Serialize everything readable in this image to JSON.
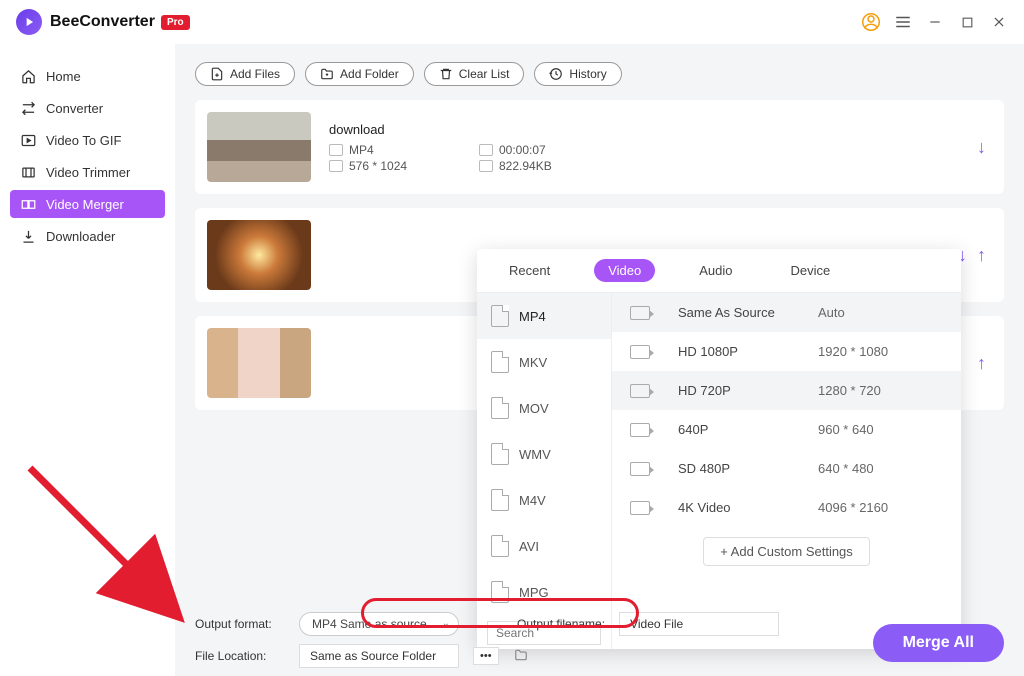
{
  "app": {
    "title": "BeeConverter",
    "badge": "Pro"
  },
  "sidebar": {
    "items": [
      {
        "label": "Home"
      },
      {
        "label": "Converter"
      },
      {
        "label": "Video To GIF"
      },
      {
        "label": "Video Trimmer"
      },
      {
        "label": "Video Merger"
      },
      {
        "label": "Downloader"
      }
    ]
  },
  "actions": {
    "add_files": "Add Files",
    "add_folder": "Add Folder",
    "clear_list": "Clear List",
    "history": "History"
  },
  "files": [
    {
      "name": "download",
      "format": "MP4",
      "duration": "00:00:07",
      "dimensions": "576 * 1024",
      "size": "822.94KB"
    }
  ],
  "popup": {
    "tabs": {
      "recent": "Recent",
      "video": "Video",
      "audio": "Audio",
      "device": "Device"
    },
    "formats": [
      "MP4",
      "MKV",
      "MOV",
      "WMV",
      "M4V",
      "AVI",
      "MPG"
    ],
    "search_placeholder": "Search",
    "resolutions": [
      {
        "name": "Same As Source",
        "dim": "Auto"
      },
      {
        "name": "HD 1080P",
        "dim": "1920 * 1080"
      },
      {
        "name": "HD 720P",
        "dim": "1280 * 720"
      },
      {
        "name": "640P",
        "dim": "960 * 640"
      },
      {
        "name": "SD 480P",
        "dim": "640 * 480"
      },
      {
        "name": "4K Video",
        "dim": "4096 * 2160"
      }
    ],
    "add_custom": "+ Add Custom Settings"
  },
  "bottom": {
    "output_format_label": "Output format:",
    "output_format_value": "MP4 Same as source",
    "output_filename_label": "Output filename:",
    "output_filename_value": "Video File",
    "file_location_label": "File Location:",
    "file_location_value": "Same as Source Folder",
    "dots": "•••",
    "merge": "Merge All"
  }
}
